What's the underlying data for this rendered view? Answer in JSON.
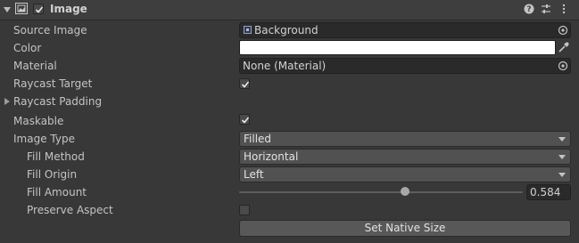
{
  "component": {
    "title": "Image",
    "enabled": true
  },
  "fields": {
    "source_image": {
      "label": "Source Image",
      "value": "Background"
    },
    "color": {
      "label": "Color",
      "value": "#ffffff"
    },
    "material": {
      "label": "Material",
      "value": "None (Material)"
    },
    "raycast_target": {
      "label": "Raycast Target",
      "checked": true
    },
    "raycast_padding": {
      "label": "Raycast Padding"
    },
    "maskable": {
      "label": "Maskable",
      "checked": true
    },
    "image_type": {
      "label": "Image Type",
      "value": "Filled"
    },
    "fill_method": {
      "label": "Fill Method",
      "value": "Horizontal"
    },
    "fill_origin": {
      "label": "Fill Origin",
      "value": "Left"
    },
    "fill_amount": {
      "label": "Fill Amount",
      "value": "0.584",
      "fraction": 0.584
    },
    "preserve_aspect": {
      "label": "Preserve Aspect",
      "checked": false
    }
  },
  "actions": {
    "set_native_size": "Set Native Size"
  },
  "icons": {
    "help": "help-icon",
    "presets": "presets-icon",
    "menu": "kebab-menu-icon"
  }
}
